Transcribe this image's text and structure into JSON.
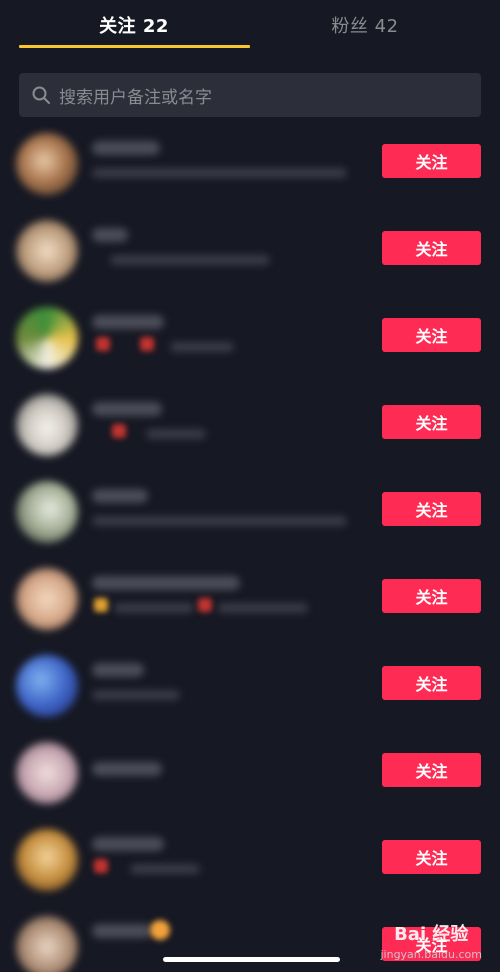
{
  "tabs": {
    "following": "关注 22",
    "fans": "粉丝 42"
  },
  "search": {
    "placeholder": "搜索用户备注或名字",
    "icon": "search-icon"
  },
  "list": {
    "follow_label": "关注"
  },
  "watermark": {
    "logo": "Bai 经验",
    "url": "jingyan.baidu.com"
  },
  "colors": {
    "background": "#161823",
    "follow_button": "#fe2c55",
    "tab_underline": "#f9c62f",
    "search_bg": "#2c2e3a"
  }
}
